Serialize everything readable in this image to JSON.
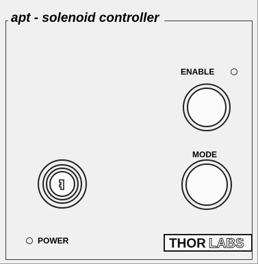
{
  "panel": {
    "title": "apt - solenoid controller",
    "enable_label": "ENABLE",
    "mode_label": "MODE",
    "power_label": "POWER",
    "logo_text": {
      "bold": "THOR",
      "outline": "LABS"
    }
  },
  "colors": {
    "panel_bg": "#f0f0f0",
    "stroke": "#222222"
  },
  "icons": {
    "key": "key-slot-icon",
    "led": "led-indicator-icon"
  }
}
